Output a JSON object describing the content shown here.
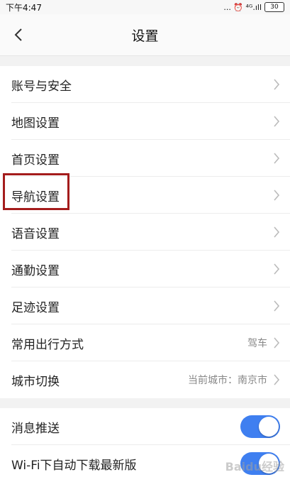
{
  "status_bar": {
    "time": "下午4:47",
    "indicators": "... ⏰ ⁴ᴳ.ıll",
    "battery": "30"
  },
  "nav": {
    "title": "设置"
  },
  "group1": [
    {
      "label": "账号与安全",
      "value": ""
    },
    {
      "label": "地图设置",
      "value": ""
    },
    {
      "label": "首页设置",
      "value": ""
    },
    {
      "label": "导航设置",
      "value": ""
    },
    {
      "label": "语音设置",
      "value": ""
    },
    {
      "label": "通勤设置",
      "value": ""
    },
    {
      "label": "足迹设置",
      "value": ""
    },
    {
      "label": "常用出行方式",
      "value": "驾车"
    },
    {
      "label": "城市切换",
      "value": "当前城市：南京市"
    }
  ],
  "group2": [
    {
      "label": "消息推送",
      "toggle_on": true
    },
    {
      "label": "Wi-Fi下自动下载最新版",
      "toggle_on": true
    }
  ],
  "colors": {
    "accent": "#3f7ff0",
    "highlight_border": "#a41c1c"
  },
  "watermark": "Baidu经验"
}
